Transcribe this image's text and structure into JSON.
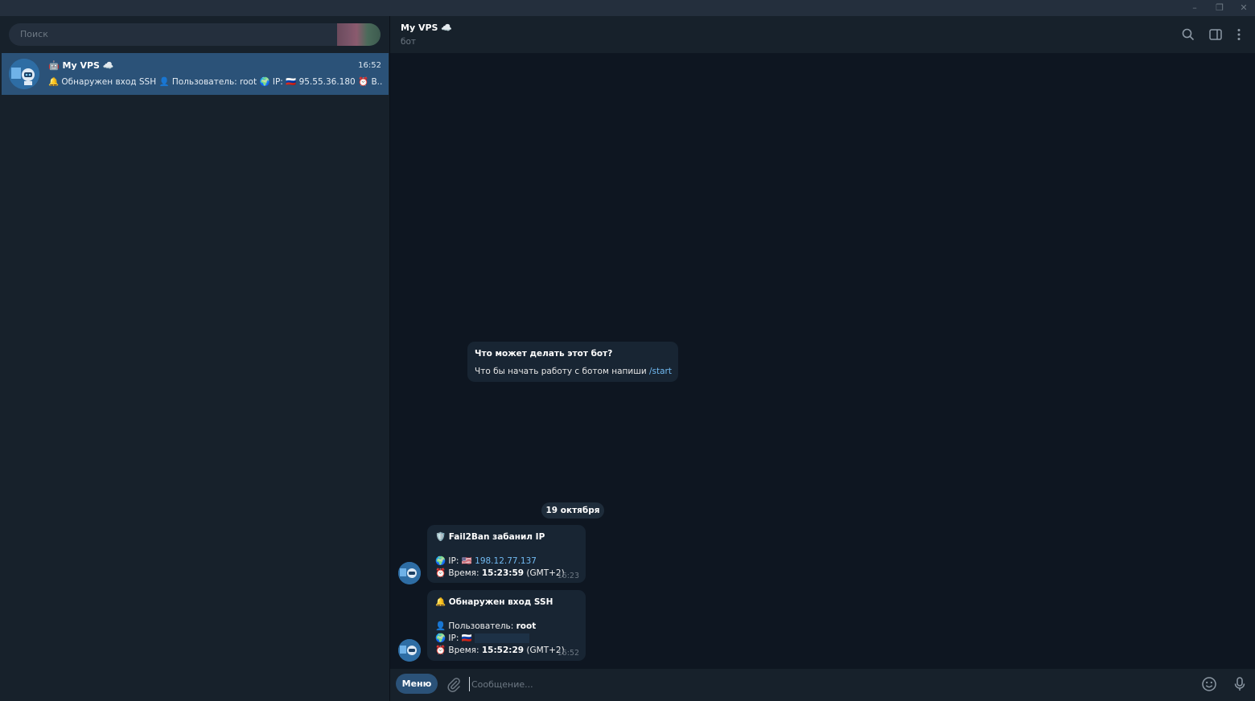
{
  "window": {
    "minimize": "–",
    "maximize": "❐",
    "close": "✕"
  },
  "sidebar": {
    "search_placeholder": "Поиск",
    "chat": {
      "name": "🤖 My VPS ☁️",
      "time": "16:52",
      "preview": "🔔 Обнаружен вход SSH 👤 Пользователь: root 🌍 IP: 🇷🇺 95.55.36.180 ⏰ В..."
    }
  },
  "header": {
    "title": "My VPS ☁️",
    "subtitle": "бот"
  },
  "intro": {
    "title": "Что может делать этот бот?",
    "text": "Что бы начать работу с ботом напиши ",
    "command": "/start"
  },
  "date_separator": "19 октября",
  "messages": [
    {
      "title": "🛡️ Fail2Ban забанил IP",
      "ip_label": "🌍 IP: 🇺🇸 ",
      "ip_value": "198.12.77.137",
      "time_label": "⏰ Время: ",
      "time_value": "15:23:59",
      "tz": " (GMT+2)",
      "time": "16:23"
    },
    {
      "title": "🔔 Обнаружен вход SSH",
      "user_label": "👤 Пользователь: ",
      "user_value": "root",
      "ip_label": "🌍 IP: 🇷🇺 ",
      "time_label": "⏰ Время: ",
      "time_value": "15:52:29",
      "tz": " (GMT+2)",
      "time": "16:52"
    }
  ],
  "composer": {
    "menu_label": "Меню",
    "placeholder": "Сообщение..."
  }
}
